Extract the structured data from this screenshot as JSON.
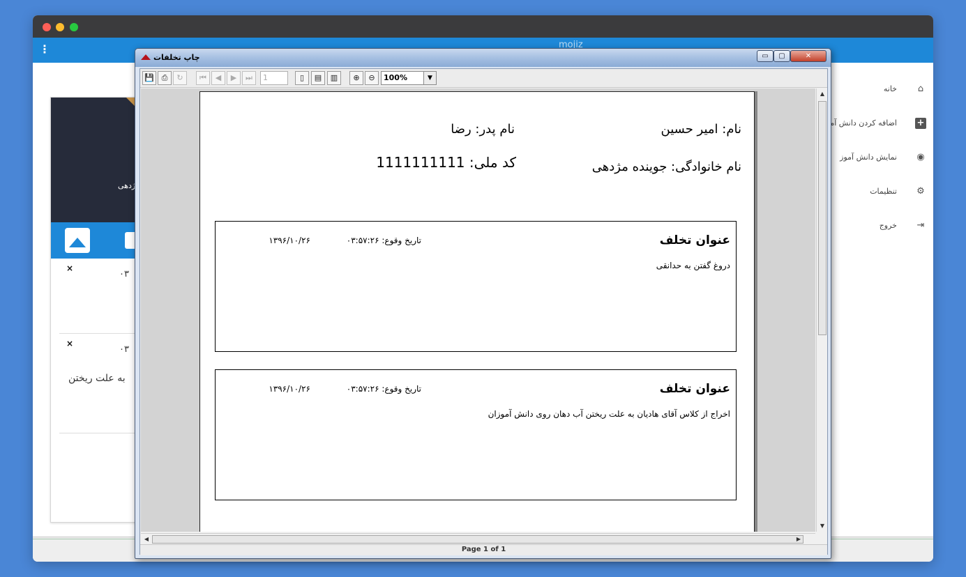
{
  "app": {
    "title": "mojiz",
    "menu_glyph": "⋮"
  },
  "sidebar": {
    "items": [
      {
        "label": "خانه",
        "icon": "home-icon",
        "glyph": "⌂"
      },
      {
        "label": "اضافه کردن دانش آموز",
        "icon": "plus-square-icon",
        "glyph": "+"
      },
      {
        "label": "نمایش دانش آموز",
        "icon": "eye-icon",
        "glyph": "◉"
      },
      {
        "label": "تنظیمات",
        "icon": "gears-icon",
        "glyph": "⚙"
      },
      {
        "label": "خروج",
        "icon": "logout-icon",
        "glyph": "⇥"
      }
    ]
  },
  "card": {
    "name_fragment": "ژدهی",
    "item1_fragment": "۰۳",
    "item2_fragment": "۰۳",
    "text_fragment": "به علت ریختن",
    "close_glyph": "×"
  },
  "dialog": {
    "title": "چاپ تخلفات",
    "min_glyph": "▭",
    "max_glyph": "▢",
    "close_glyph": "✕",
    "toolbar": {
      "page_value": "1",
      "zoom_value": "100%",
      "zoom_arrow": "▼",
      "save_glyph": "💾",
      "print_glyph": "⎙",
      "refresh_glyph": "↻",
      "first_glyph": "⏮",
      "prev_glyph": "◀",
      "next_glyph": "▶",
      "last_glyph": "⏭",
      "actual_size_glyph": "▯",
      "fit_page_glyph": "▤",
      "fit_width_glyph": "▥",
      "zoom_in_glyph": "⊕",
      "zoom_out_glyph": "⊖"
    },
    "status": "Page 1 of 1",
    "scroll": {
      "up": "▲",
      "down": "▼",
      "left": "◀",
      "right": "▶"
    }
  },
  "report": {
    "name": "نام: امیر حسین",
    "father": "نام پدر: رضا",
    "family": "نام خانوادگی: جوینده مژدهی",
    "national_id": "کد ملی: 1111111111",
    "violations": [
      {
        "title": "عنوان تخلف",
        "date_label": "تاریخ وقوع: ۰۳:۵۷:۲۶",
        "date_value": "۱۳۹۶/۱۰/۲۶",
        "description": "دروغ گفتن به حدانقی"
      },
      {
        "title": "عنوان تخلف",
        "date_label": "تاریخ وقوع: ۰۳:۵۷:۲۶",
        "date_value": "۱۳۹۶/۱۰/۲۶",
        "description": "اخراج از کلاس آقای هادیان به علت ریختن آب دهان روی دانش آموزان"
      }
    ]
  }
}
